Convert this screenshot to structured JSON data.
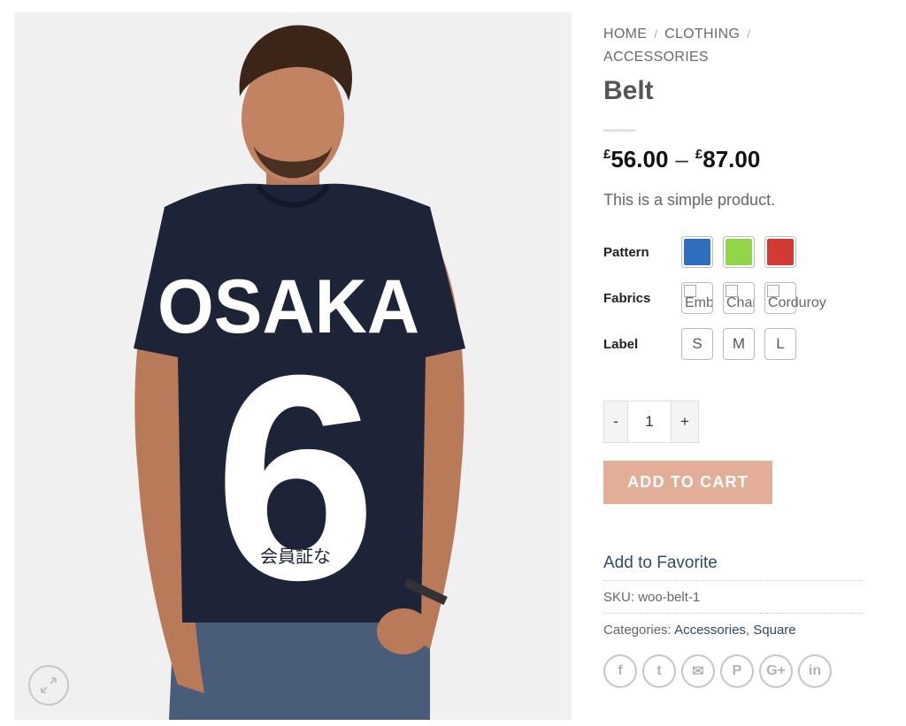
{
  "breadcrumb": {
    "home": "HOME",
    "clothing": "CLOTHING",
    "accessories": "ACCESSORIES",
    "separator": "/"
  },
  "product": {
    "title": "Belt",
    "price_low": "56.00",
    "price_high": "87.00",
    "currency": "£",
    "price_dash": "–",
    "description": "This is a simple product."
  },
  "shirt_print": {
    "team": "OSAKA",
    "number": "6",
    "kanji": "会員証な"
  },
  "attributes": {
    "pattern": {
      "label": "Pattern",
      "colors": [
        "#2f6fbd",
        "#93d54a",
        "#d23a35"
      ]
    },
    "fabrics": {
      "label": "Fabrics",
      "options": [
        "Embo",
        "Cham",
        "Corduroy"
      ]
    },
    "label": {
      "label": "Label",
      "options": [
        "S",
        "M",
        "L"
      ]
    }
  },
  "quantity": {
    "minus": "-",
    "value": "1",
    "plus": "+"
  },
  "cart": {
    "button": "ADD TO CART"
  },
  "meta": {
    "favorite": "Add to Favorite",
    "sku_label": "SKU:",
    "sku": "woo-belt-1",
    "categories_label": "Categories:",
    "categories": [
      "Accessories",
      "Square"
    ],
    "categories_separator": ","
  },
  "social": {
    "icons": [
      "facebook-icon",
      "twitter-icon",
      "email-icon",
      "pinterest-icon",
      "google-plus-icon",
      "linkedin-icon"
    ],
    "labels": [
      "f",
      "t",
      "✉",
      "P",
      "G+",
      "in"
    ]
  },
  "colors": {
    "button": "#e3ae98",
    "link": "#2f4a64",
    "shirt": "#1d2438"
  }
}
